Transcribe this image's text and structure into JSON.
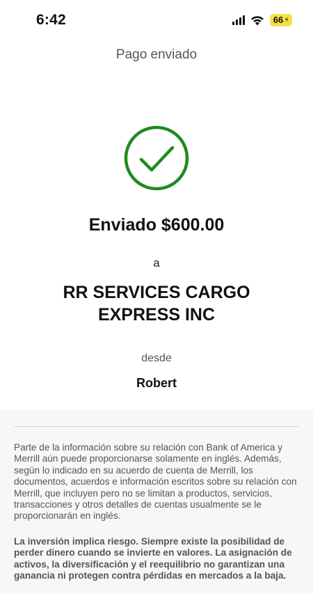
{
  "status_bar": {
    "time": "6:42",
    "battery_level": "66",
    "icons": [
      "cellular-signal-icon",
      "wifi-icon",
      "charging-bolt-icon"
    ]
  },
  "header": {
    "title": "Pago enviado"
  },
  "confirmation": {
    "icon": "checkmark-circle-icon",
    "accent_color": "#1f8a1f",
    "sent_text": "Enviado $600.00",
    "to_label": "a",
    "recipient": "RR SERVICES CARGO EXPRESS INC",
    "from_label": "desde",
    "sender": "Robert"
  },
  "disclosures": {
    "language_notice": "Parte de la información sobre su relación con Bank of America y Merrill aún puede proporcionarse solamente en inglés. Además, según lo indicado en su acuerdo de cuenta de Merrill, los documentos, acuerdos e información escritos sobre su relación con Merrill, que incluyen pero no se limitan a productos, servicios, transacciones y otros detalles de cuentas usualmente se le proporcionarán en inglés.",
    "risk_notice": "La inversión implica riesgo. Siempre existe la posibilidad de perder dinero cuando se invierte en valores. La asignación de activos, la diversificación y el reequilibrio no garantizan una ganancia ni protegen contra pérdidas en mercados a la baja."
  }
}
